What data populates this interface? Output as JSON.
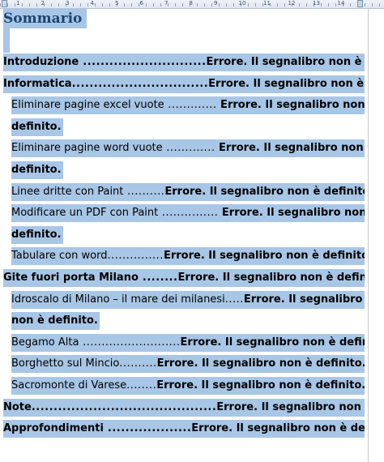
{
  "ruler": {
    "numbers": [
      "1",
      "2",
      "3",
      "4",
      "5",
      "6",
      "7",
      "8",
      "9",
      "10",
      "11",
      "12",
      "13",
      "14"
    ]
  },
  "toc": {
    "title": "Sommario",
    "entries": [
      {
        "level": 1,
        "lines": [
          {
            "title": "Introduzione",
            "dots": " ............................",
            "error": "Errore. Il segnalibro non è definito."
          }
        ]
      },
      {
        "level": 1,
        "lines": [
          {
            "title": "Informatica",
            "dots": "...............................",
            "error": "Errore. Il segnalibro non è definito."
          }
        ]
      },
      {
        "level": 2,
        "lines": [
          {
            "title": "Eliminare pagine excel vuote",
            "dots": " .............",
            "error": " Errore. Il segnalibro non è"
          },
          {
            "title": "",
            "dots": "",
            "error": "definito."
          }
        ]
      },
      {
        "level": 2,
        "lines": [
          {
            "title": "Eliminare pagine word vuote",
            "dots": " .............",
            "error": " Errore. Il segnalibro non è"
          },
          {
            "title": "",
            "dots": "",
            "error": "definito."
          }
        ]
      },
      {
        "level": 2,
        "lines": [
          {
            "title": "Linee dritte con Paint",
            "dots": " ..........",
            "error": "Errore. Il segnalibro non è definito."
          }
        ]
      },
      {
        "level": 2,
        "lines": [
          {
            "title": "Modificare un PDF con Paint",
            "dots": " ...............",
            "error": " Errore. Il segnalibro non è"
          },
          {
            "title": "",
            "dots": "",
            "error": "definito."
          }
        ]
      },
      {
        "level": 2,
        "lines": [
          {
            "title": "Tabulare con word",
            "dots": "...............",
            "error": "Errore. Il segnalibro non è definito."
          }
        ]
      },
      {
        "level": 1,
        "lines": [
          {
            "title": "Gite fuori porta Milano",
            "dots": " ........",
            "error": "Errore. Il segnalibro non è definito."
          }
        ]
      },
      {
        "level": 2,
        "lines": [
          {
            "title": "Idroscalo di Milano – il mare dei milanesi",
            "dots": ".....",
            "error": "Errore. Il segnalibro"
          },
          {
            "title": "",
            "dots": "",
            "error": "non è definito."
          }
        ]
      },
      {
        "level": 2,
        "lines": [
          {
            "title": "Begamo Alta",
            "dots": " ..........................",
            "error": "Errore. Il segnalibro non è definito."
          }
        ]
      },
      {
        "level": 2,
        "lines": [
          {
            "title": "Borghetto sul Mincio",
            "dots": "..........",
            "error": "Errore. Il segnalibro non è definito."
          }
        ]
      },
      {
        "level": 2,
        "lines": [
          {
            "title": "Sacromonte di Varese",
            "dots": "........",
            "error": "Errore. Il segnalibro non è definito."
          }
        ]
      },
      {
        "level": 1,
        "lines": [
          {
            "title": "Note",
            "dots": "..........................................",
            "error": "Errore. Il segnalibro non è definito."
          }
        ]
      },
      {
        "level": 1,
        "lines": [
          {
            "title": "Approfondimenti",
            "dots": " ...................",
            "error": "Errore. Il segnalibro non è definito."
          }
        ]
      }
    ]
  }
}
